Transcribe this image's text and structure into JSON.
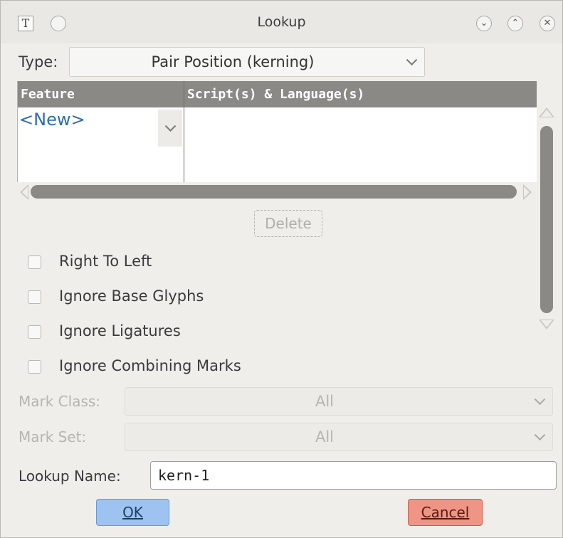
{
  "window": {
    "title": "Lookup",
    "app_icon_glyph": "T",
    "controls": [
      {
        "name": "minimize",
        "glyph": "⌄"
      },
      {
        "name": "maximize",
        "glyph": "⌃"
      },
      {
        "name": "close",
        "glyph": "✕"
      }
    ]
  },
  "type_row": {
    "label": "Type:",
    "value": "Pair Position (kerning)"
  },
  "table": {
    "columns": [
      "Feature",
      "Script(s) & Language(s)"
    ],
    "rows": [
      {
        "feature": "<New>",
        "scripts": ""
      }
    ]
  },
  "delete_button": "Delete",
  "checkboxes": [
    {
      "label": "Right To Left",
      "checked": false
    },
    {
      "label": "Ignore Base Glyphs",
      "checked": false
    },
    {
      "label": "Ignore Ligatures",
      "checked": false
    },
    {
      "label": "Ignore Combining Marks",
      "checked": false
    }
  ],
  "mark_class": {
    "label": "Mark Class:",
    "value": "All"
  },
  "mark_set": {
    "label": "Mark Set:",
    "value": "All"
  },
  "lookup_name": {
    "label": "Lookup Name:",
    "value": "kern-1"
  },
  "buttons": {
    "ok": "OK",
    "cancel": "Cancel"
  },
  "colors": {
    "ok_bg": "#9fc3f0",
    "cancel_bg": "#ee9585",
    "table_header": "#8a8986",
    "link_blue": "#2f6da8"
  }
}
